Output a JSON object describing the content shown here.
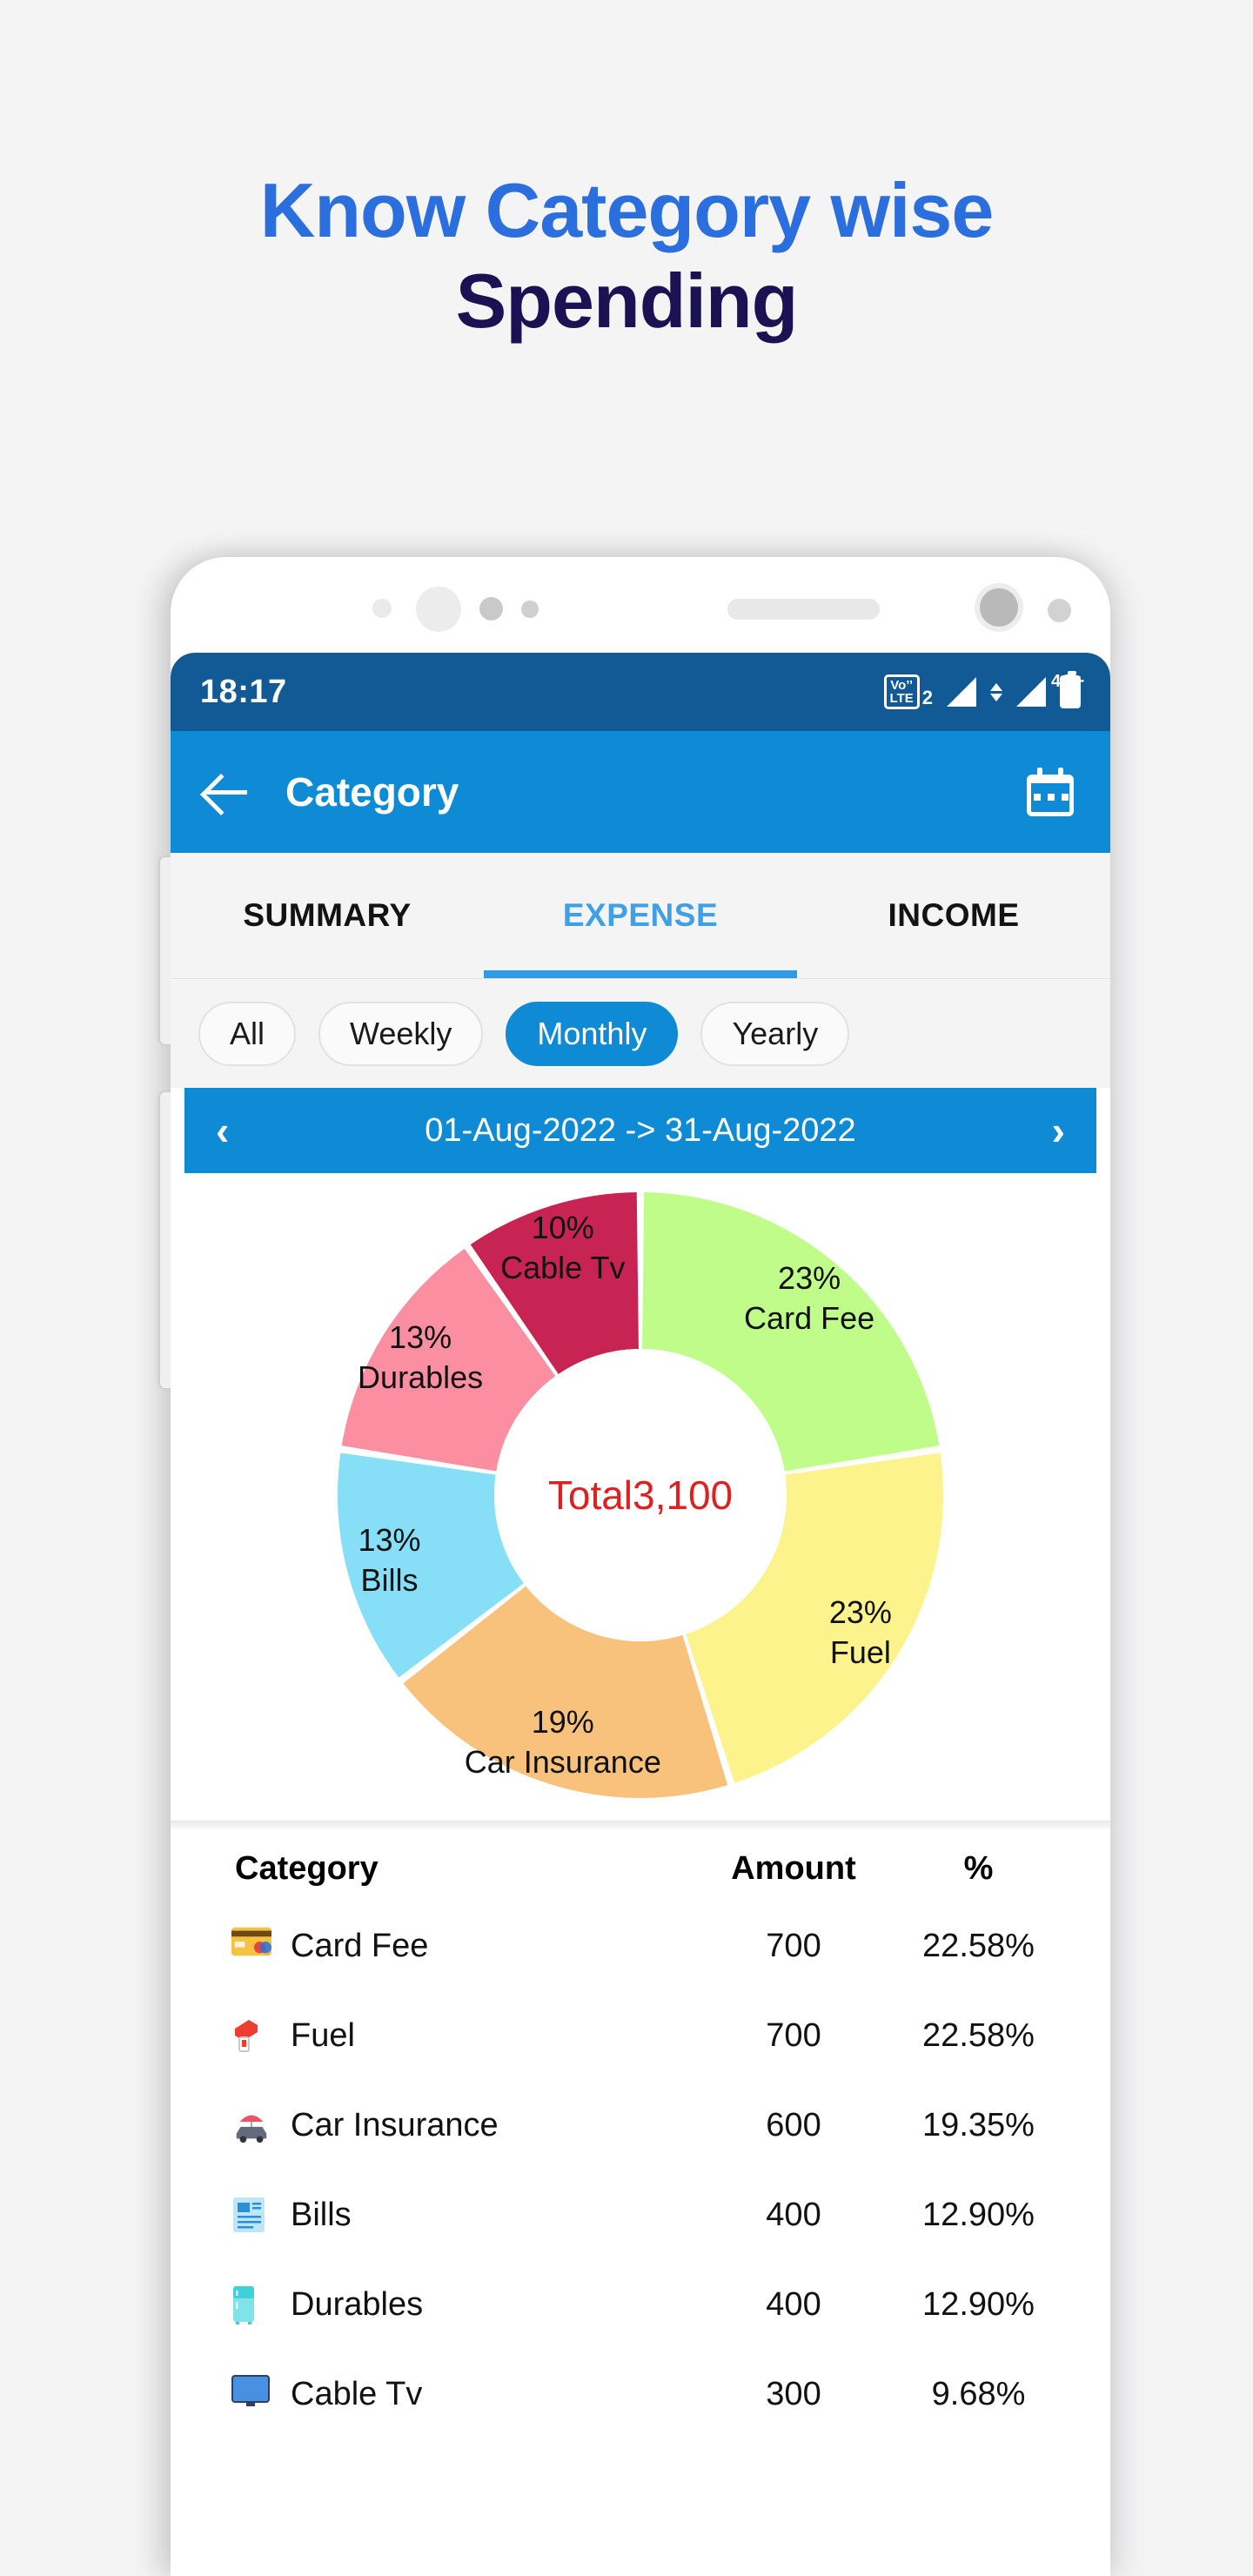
{
  "promo": {
    "line1": "Know Category wise",
    "line2": "Spending",
    "color_line1": "#2B6FDE",
    "color_line2": "#1A1252"
  },
  "statusbar": {
    "time": "18:17",
    "volte_top": "Vo’’",
    "volte_bottom": "LTE",
    "sim_number": "2",
    "network": "4G",
    "network_plus": "+",
    "icons": [
      "volte-icon",
      "signal-icon",
      "data-arrows-icon",
      "signal-4g-icon",
      "battery-icon"
    ]
  },
  "appbar": {
    "title": "Category",
    "back_icon": "back-arrow-icon",
    "calendar_icon": "calendar-icon",
    "background": "#0F8AD4"
  },
  "tabs": [
    {
      "label": "SUMMARY",
      "active": false
    },
    {
      "label": "EXPENSE",
      "active": true
    },
    {
      "label": "INCOME",
      "active": false
    }
  ],
  "chips": [
    {
      "label": "All",
      "active": false
    },
    {
      "label": "Weekly",
      "active": false
    },
    {
      "label": "Monthly",
      "active": true
    },
    {
      "label": "Yearly",
      "active": false
    }
  ],
  "daterange": {
    "prev_icon": "chevron-left-icon",
    "next_icon": "chevron-right-icon",
    "label": "01-Aug-2022 -> 31-Aug-2022"
  },
  "chart_data": {
    "type": "pie",
    "title": "",
    "center_label": "Total3,100",
    "center_color": "#E02020",
    "total": 3100,
    "categories": [
      "Card Fee",
      "Fuel",
      "Car Insurance",
      "Bills",
      "Durables",
      "Cable Tv"
    ],
    "values": [
      700,
      700,
      600,
      400,
      400,
      300
    ],
    "percent_labels": [
      "23%",
      "23%",
      "19%",
      "13%",
      "13%",
      "10%"
    ],
    "percents": [
      22.58,
      22.58,
      19.35,
      12.9,
      12.9,
      9.68
    ],
    "colors": [
      "#BFFC8A",
      "#FCF38C",
      "#F8C27C",
      "#86DFF7",
      "#FB8FA1",
      "#C72454"
    ],
    "legend": "labels-on-slices",
    "grid": false
  },
  "table": {
    "headers": {
      "category": "Category",
      "amount": "Amount",
      "percent": "%"
    },
    "rows": [
      {
        "icon": "credit-card-icon",
        "category": "Card Fee",
        "amount": "700",
        "percent": "22.58%"
      },
      {
        "icon": "fuel-pump-icon",
        "category": "Fuel",
        "amount": "700",
        "percent": "22.58%"
      },
      {
        "icon": "car-insurance-icon",
        "category": "Car Insurance",
        "amount": "600",
        "percent": "19.35%"
      },
      {
        "icon": "bills-icon",
        "category": "Bills",
        "amount": "400",
        "percent": "12.90%"
      },
      {
        "icon": "refrigerator-icon",
        "category": "Durables",
        "amount": "400",
        "percent": "12.90%"
      },
      {
        "icon": "television-icon",
        "category": "Cable Tv",
        "amount": "300",
        "percent": "9.68%"
      }
    ]
  }
}
